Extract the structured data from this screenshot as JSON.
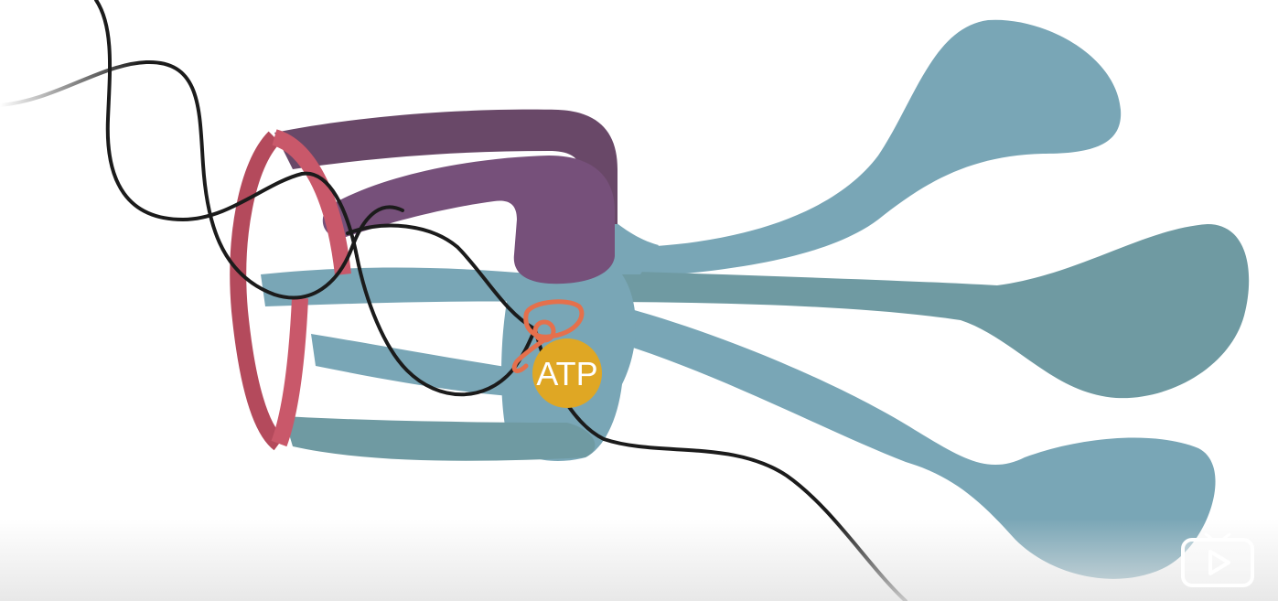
{
  "diagram": {
    "atp_label": "ATP",
    "colors": {
      "protein_body": "#79a6b6",
      "protein_body_dark": "#6f9aa2",
      "clamp_arm": "#76507a",
      "clamp_arm_dark": "#694868",
      "ring": "#c9586a",
      "ring_dark": "#b44a5c",
      "dna_strand": "#1b1b1b",
      "atp_circle": "#dfa724",
      "loop": "#e5704c"
    }
  },
  "overlay": {
    "play_icon": "play-icon",
    "badge_color": "#ffffff"
  }
}
